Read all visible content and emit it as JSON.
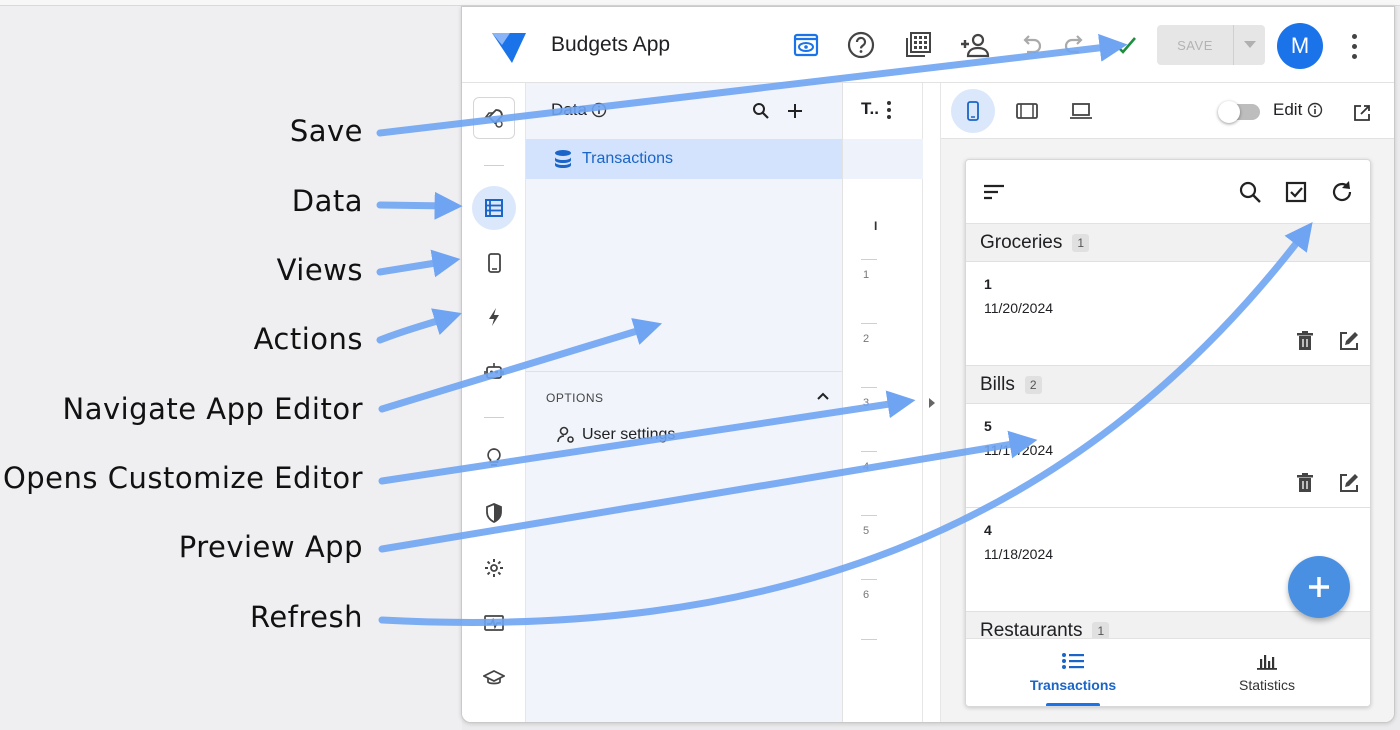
{
  "annotations": {
    "save": "Save",
    "data": "Data",
    "views": "Views",
    "actions": "Actions",
    "navigate": "Navigate App Editor",
    "customize": "Opens Customize Editor",
    "preview": "Preview App",
    "refresh": "Refresh"
  },
  "header": {
    "app_title": "Budgets App",
    "save_label": "SAVE",
    "avatar_initial": "M"
  },
  "data_panel": {
    "title": "Data",
    "table_name": "Transactions",
    "options_label": "OPTIONS",
    "user_settings": "User settings"
  },
  "column_panel": {
    "header": "T..",
    "first_char": "I",
    "row_numbers": [
      "1",
      "2",
      "3",
      "4",
      "5",
      "6"
    ]
  },
  "preview": {
    "edit_label": "Edit",
    "groups": [
      {
        "name": "Groceries",
        "count": "1"
      },
      {
        "name": "Bills",
        "count": "2"
      },
      {
        "name": "Restaurants",
        "count": "1"
      }
    ],
    "cards": [
      {
        "number": "1",
        "date": "11/20/2024"
      },
      {
        "number": "5",
        "date": "11/17/2024"
      },
      {
        "number": "4",
        "date": "11/18/2024"
      }
    ],
    "tabs": [
      {
        "label": "Transactions"
      },
      {
        "label": "Statistics"
      }
    ]
  },
  "colors": {
    "accent": "#1a73e8",
    "arrow": "#6fa4f2",
    "selected_row": "#d3e3fd",
    "fab": "#4a90e2"
  }
}
